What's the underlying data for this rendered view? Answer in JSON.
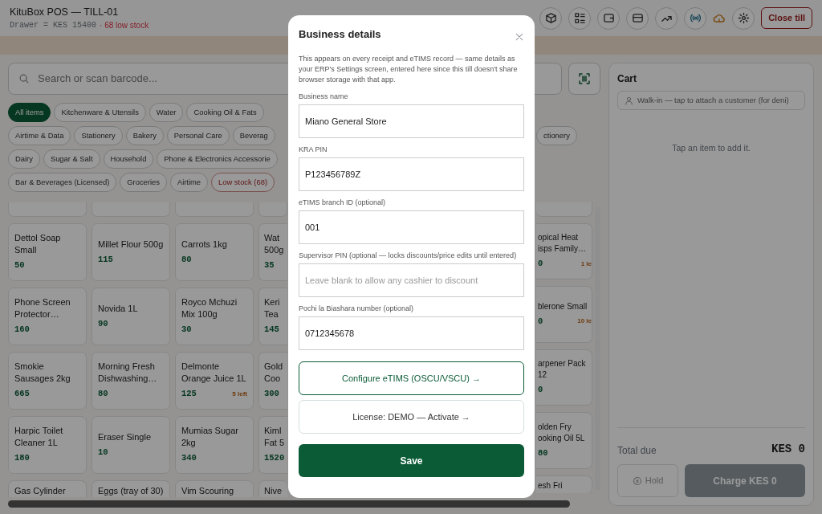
{
  "header": {
    "title": "KituBox POS — TILL-01",
    "drawer": "Drawer = KES 15400",
    "low_stock": "· 68 low stock",
    "close_till": "Close till"
  },
  "search": {
    "placeholder": "Search or scan barcode..."
  },
  "categories": {
    "items": [
      {
        "label": "All items",
        "selected": true,
        "kind": "category"
      },
      {
        "label": "Kitchenware & Utensils",
        "selected": false,
        "kind": "category"
      },
      {
        "label": "Water",
        "selected": false,
        "kind": "category"
      },
      {
        "label": "Cooking Oil & Fats",
        "selected": false,
        "kind": "category"
      },
      {
        "label": "Airtime & Data",
        "selected": false,
        "kind": "category"
      },
      {
        "label": "Stationery",
        "selected": false,
        "kind": "category"
      },
      {
        "label": "Bakery",
        "selected": false,
        "kind": "category"
      },
      {
        "label": "Personal Care",
        "selected": false,
        "kind": "category"
      },
      {
        "label": "Beverag",
        "selected": false,
        "kind": "category"
      },
      {
        "label": "Dairy",
        "selected": false,
        "kind": "category"
      },
      {
        "label": "Sugar & Salt",
        "selected": false,
        "kind": "category"
      },
      {
        "label": "Household",
        "selected": false,
        "kind": "category"
      },
      {
        "label": "Phone & Electronics Accessorie",
        "selected": false,
        "kind": "category"
      },
      {
        "label": "Bar & Beverages (Licensed)",
        "selected": false,
        "kind": "category"
      },
      {
        "label": "Groceries",
        "selected": false,
        "kind": "category"
      },
      {
        "label": "Airtime",
        "selected": false,
        "kind": "category"
      },
      {
        "label": "Low stock (68)",
        "selected": false,
        "kind": "low_stock"
      }
    ],
    "right_side": [
      {
        "label": "ctionery",
        "selected": false,
        "kind": "category"
      }
    ]
  },
  "products": [
    {
      "left": [
        {
          "name": "Dettol Soap Small",
          "price": "50"
        },
        {
          "name": "Millet Flour 500g",
          "price": "115"
        },
        {
          "name": "Carrots 1kg",
          "price": "80"
        },
        {
          "name": "Wat 500g",
          "price": "35"
        }
      ],
      "right": {
        "name": "opical Heat isps Family…",
        "price": "0",
        "stock": "1 le"
      }
    },
    {
      "left": [
        {
          "name": "Phone Screen Protector…",
          "price": "160"
        },
        {
          "name": "Novida 1L",
          "price": "90"
        },
        {
          "name": "Royco Mchuzi Mix 100g",
          "price": "30"
        },
        {
          "name": "Keri Tea",
          "price": "145"
        }
      ],
      "right": {
        "name": "blerone Small",
        "price": "0",
        "stock": "10 le"
      }
    },
    {
      "left": [
        {
          "name": "Smokie Sausages 2kg",
          "price": "665"
        },
        {
          "name": "Morning Fresh Dishwashing…",
          "price": "80"
        },
        {
          "name": "Delmonte Orange Juice 1L",
          "price": "125",
          "stock": "5 left"
        },
        {
          "name": "Gold Coo",
          "price": "300"
        }
      ],
      "right": {
        "name": "arpener Pack 12",
        "price": "0"
      }
    },
    {
      "left": [
        {
          "name": "Harpic Toilet Cleaner 1L",
          "price": "180"
        },
        {
          "name": "Eraser Single",
          "price": "10"
        },
        {
          "name": "Mumias Sugar 2kg",
          "price": "340"
        },
        {
          "name": "Kiml Fat 5",
          "price": "1520"
        }
      ],
      "right": {
        "name": "olden Fry ooking Oil 5L",
        "price": "80"
      }
    },
    {
      "left": [
        {
          "name": "Gas Cylinder"
        },
        {
          "name": "Eggs (tray of 30)"
        },
        {
          "name": "Vim Scouring"
        },
        {
          "name": "Nive"
        }
      ],
      "right": {
        "name": "esh Fri"
      }
    }
  ],
  "cart": {
    "title": "Cart",
    "customer": "Walk-in — tap to attach a customer (for deni)",
    "empty": "Tap an item to add it.",
    "total_label": "Total due",
    "total_value": "KES 0",
    "hold": "Hold",
    "charge": "Charge KES 0",
    "charge_disabled": true
  },
  "modal": {
    "title": "Business details",
    "description": "This appears on every receipt and eTIMS record — same details as your ERP's Settings screen, entered here since this till doesn't share browser storage with that app.",
    "fields": [
      {
        "label": "Business name",
        "value": "Miano General Store"
      },
      {
        "label": "KRA PIN",
        "value": "P123456789Z"
      },
      {
        "label": "eTIMS branch ID (optional)",
        "value": "001"
      },
      {
        "label": "Supervisor PIN (optional — locks discounts/price edits until entered)",
        "placeholder": "Leave blank to allow any cashier to discount"
      },
      {
        "label": "Pochi la Biashara number (optional)",
        "value": "0712345678"
      }
    ],
    "links": [
      {
        "label": "Configure eTIMS (OSCU/VSCU) →",
        "kind": "primary"
      },
      {
        "label": "License: DEMO — Activate →",
        "kind": "muted"
      }
    ],
    "save": "Save"
  }
}
